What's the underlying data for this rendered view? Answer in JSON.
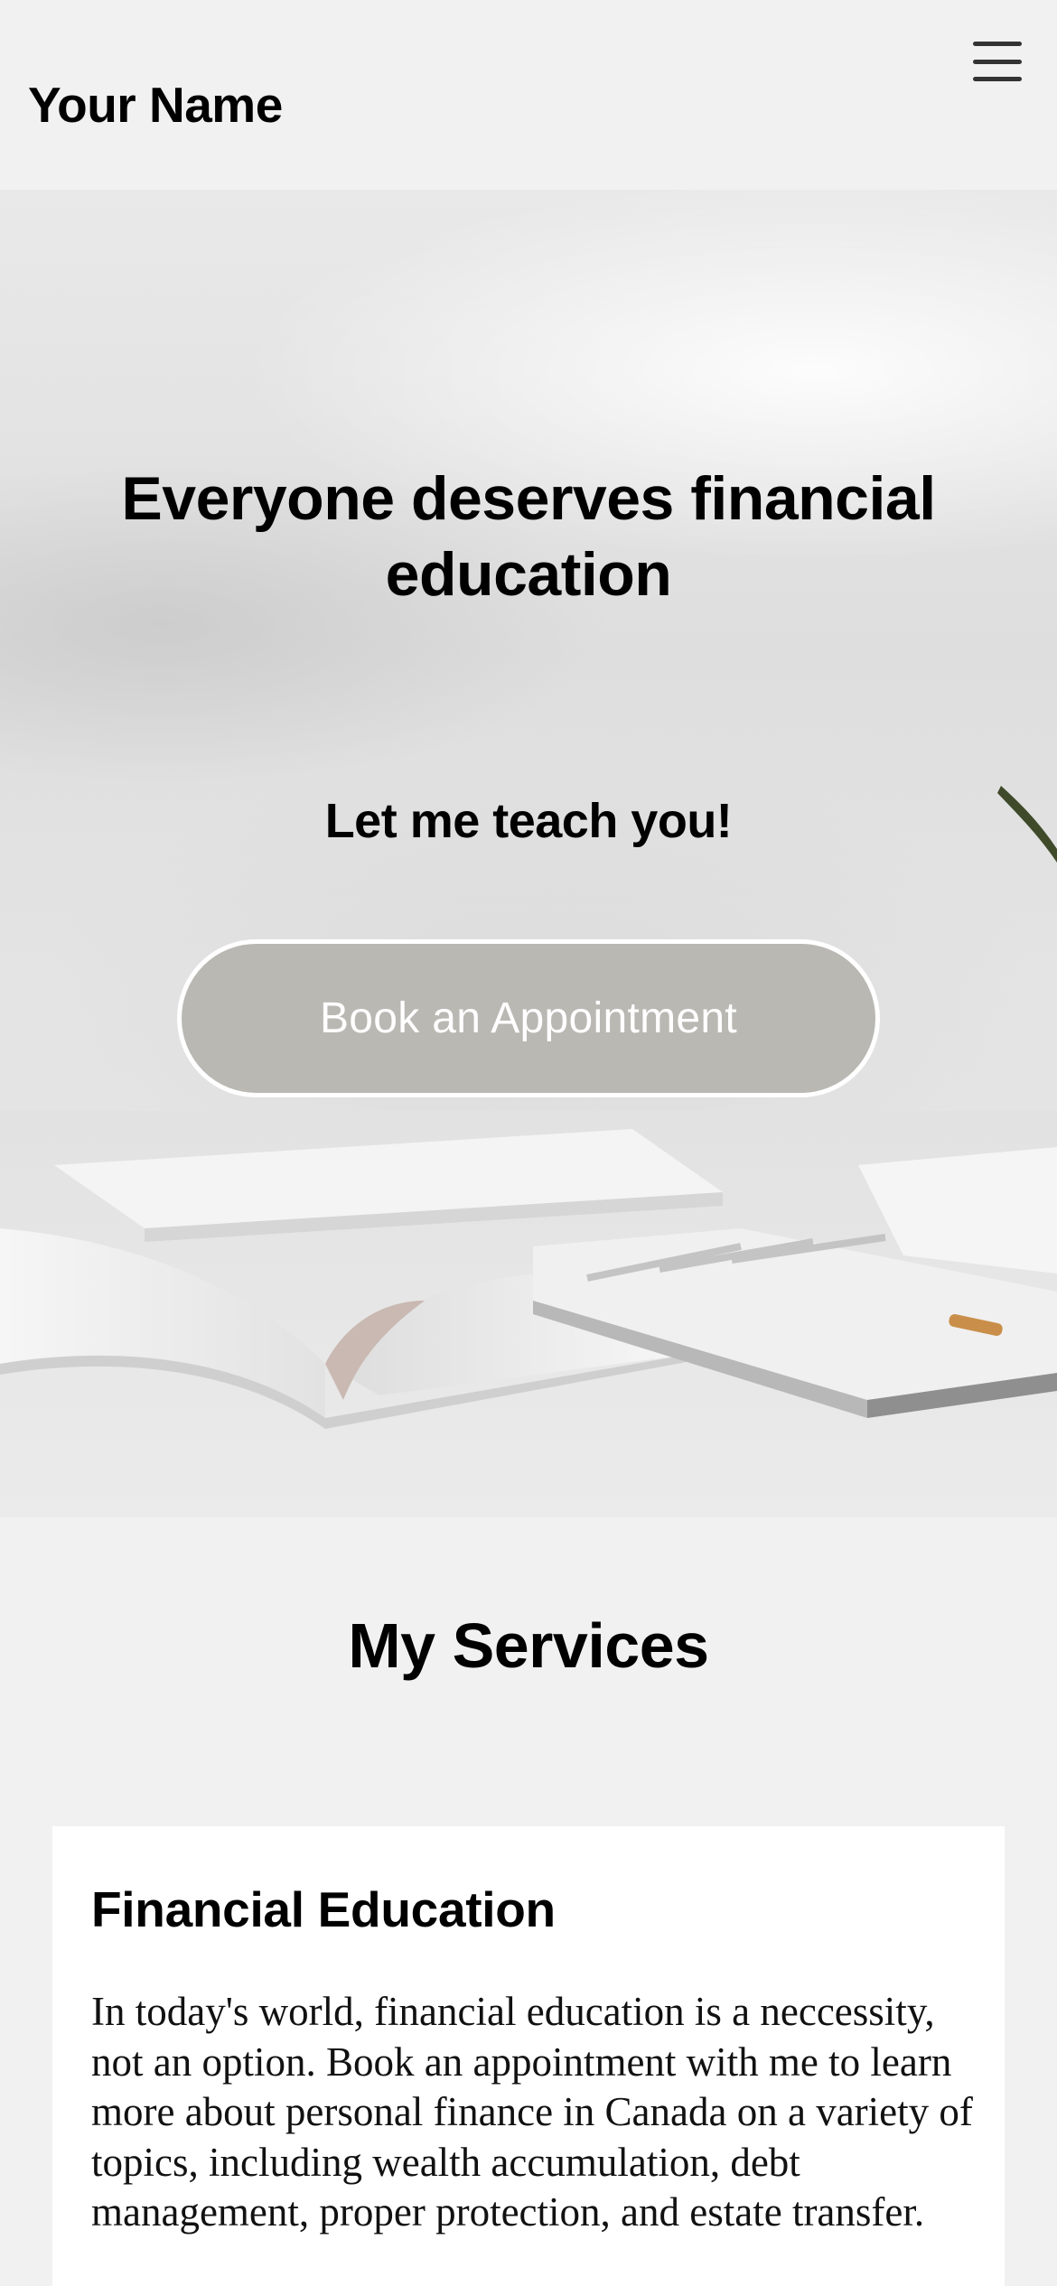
{
  "header": {
    "site_title": "Your Name",
    "menu_icon": "hamburger-menu-icon"
  },
  "hero": {
    "headline": "Everyone deserves financial education",
    "subheadline": "Let me teach you!",
    "cta_label": "Book an Appointment",
    "background_image": "white desk with open books, trays and a pencil",
    "colors": {
      "cta_background": "#bab8b3",
      "cta_border": "#ffffff",
      "cta_text": "#ffffff"
    }
  },
  "services": {
    "title": "My Services",
    "cards": [
      {
        "title": "Financial Education",
        "body": "In today's world, financial education is a neccessity, not an option. Book an appointment with me to learn more about personal finance in Canada on a variety of topics, including wealth accumulation, debt management, proper protection, and estate transfer."
      }
    ]
  },
  "colors": {
    "page_background": "#f1f1f1",
    "card_background": "#ffffff",
    "text": "#000000"
  }
}
